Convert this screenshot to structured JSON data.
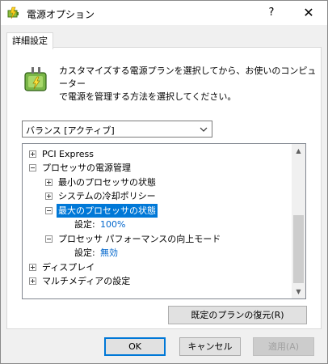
{
  "window": {
    "title": "電源オプション",
    "help_glyph": "?",
    "close_glyph": "✕"
  },
  "tab": {
    "label": "詳細設定"
  },
  "description": {
    "line1": "カスタマイズする電源プランを選択してから、お使いのコンピューター",
    "line2": "で電源を管理する方法を選択してください。"
  },
  "plan_select": {
    "value": "バランス [アクティブ]"
  },
  "tree": {
    "items": [
      {
        "label": "PCI Express",
        "expander": "plus"
      },
      {
        "label": "プロセッサの電源管理",
        "expander": "minus"
      },
      {
        "label": "最小のプロセッサの状態",
        "expander": "plus"
      },
      {
        "label": "システムの冷却ポリシー",
        "expander": "plus"
      },
      {
        "label": "最大のプロセッサの状態",
        "expander": "minus",
        "selected": true
      },
      {
        "setting_label": "設定:",
        "setting_value": "100%"
      },
      {
        "label": "プロセッサ パフォーマンスの向上モード",
        "expander": "minus"
      },
      {
        "setting_label": "設定:",
        "setting_value": "無効"
      },
      {
        "label": "ディスプレイ",
        "expander": "plus"
      },
      {
        "label": "マルチメディアの設定",
        "expander": "plus"
      }
    ]
  },
  "buttons": {
    "restore": "既定のプランの復元(R)",
    "ok": "OK",
    "cancel": "キャンセル",
    "apply": "適用(A)"
  },
  "colors": {
    "selection": "#0078d7",
    "setting_value": "#0066cc",
    "dialog_bg": "#f0f0f0"
  }
}
